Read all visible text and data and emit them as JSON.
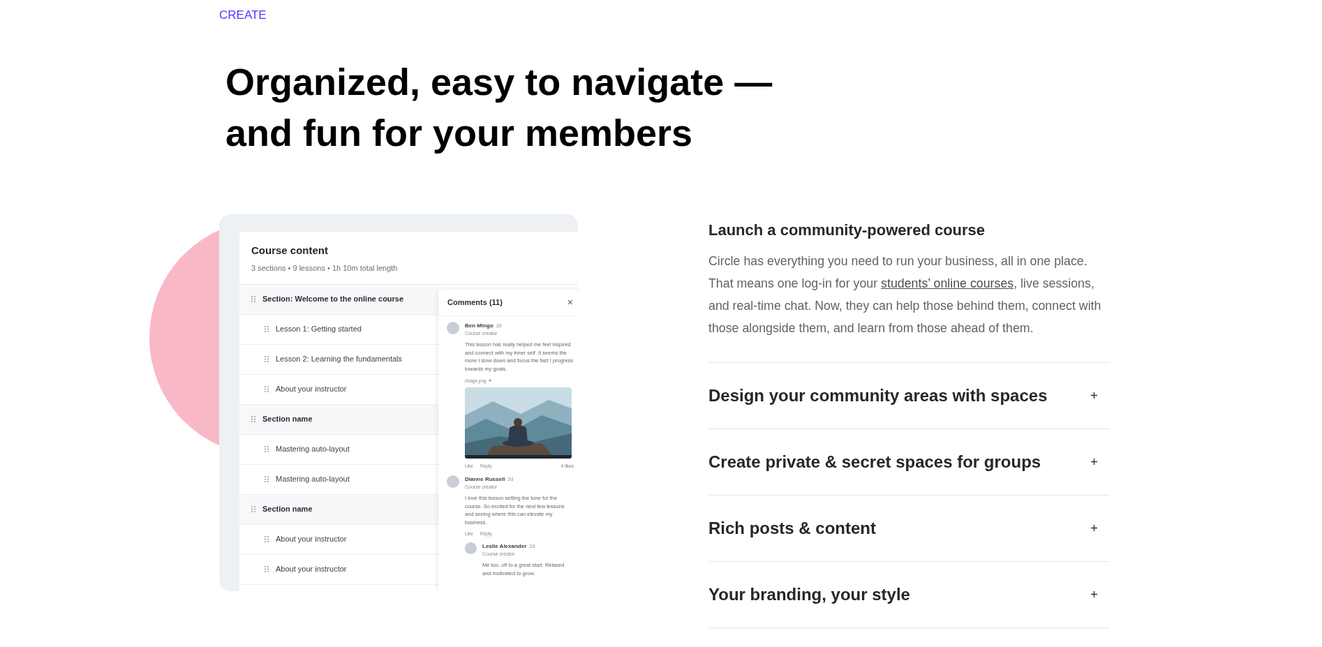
{
  "eyebrow": "CREATE",
  "headline": [
    "Organized, easy to navigate —",
    "and fun for your members"
  ],
  "course": {
    "title": "Course content",
    "summary": "3 sections • 9 lessons • 1h 10m total length",
    "rows": [
      {
        "kind": "section",
        "label": "Section: Welcome to the online course"
      },
      {
        "kind": "lesson",
        "label": "Lesson 1: Getting started"
      },
      {
        "kind": "lesson",
        "label": "Lesson 2: Learning the fundamentals"
      },
      {
        "kind": "lesson",
        "label": "About your instructor"
      },
      {
        "kind": "section",
        "label": "Section name"
      },
      {
        "kind": "lesson",
        "label": "Mastering auto-layout"
      },
      {
        "kind": "lesson",
        "label": "Mastering auto-layout"
      },
      {
        "kind": "section",
        "label": "Section name"
      },
      {
        "kind": "lesson",
        "label": "About your instructor"
      },
      {
        "kind": "lesson",
        "label": "About your instructor"
      }
    ]
  },
  "comments_panel": {
    "title": "Comments (11)",
    "close": "×",
    "comments": [
      {
        "name": "Ben Mingo",
        "time": "2d",
        "role": "Course creator",
        "text": "This lesson has really helped me feel inspired and connect with my inner self. It seems the more I slow down and focus the fast I progress towards my goals.",
        "attachment": {
          "label": "Image.png",
          "kind": "picture"
        },
        "actions": [
          "Like",
          "Reply"
        ],
        "likes": "4 likes"
      },
      {
        "name": "Dianne Russell",
        "time": "2d",
        "role": "Course creator",
        "text": "I love this lesson setting the tone for the course. So excited for the next few lessons and seeing where this can elevate my business.",
        "actions": [
          "Like",
          "Reply"
        ],
        "replies": [
          {
            "name": "Leslie Alexander",
            "time": "2d",
            "role": "Course creator",
            "text": "Me too, off to a great start. Relaxed and motivated to grow."
          }
        ]
      }
    ]
  },
  "features": [
    {
      "title": "Launch a community-powered course",
      "expanded": true,
      "body": "Circle has everything you need to run your business, all in one place. That means one log-in for your ",
      "link": "students’ online courses",
      "body_after": ", live sessions, and real-time chat. Now, they can help those behind them, connect with those alongside them, and learn from those ahead of them."
    },
    {
      "title": "Design your community areas with spaces",
      "expanded": false
    },
    {
      "title": "Create private & secret spaces for groups",
      "expanded": false
    },
    {
      "title": "Rich posts & content",
      "expanded": false
    },
    {
      "title": "Your branding, your style",
      "expanded": false
    }
  ]
}
